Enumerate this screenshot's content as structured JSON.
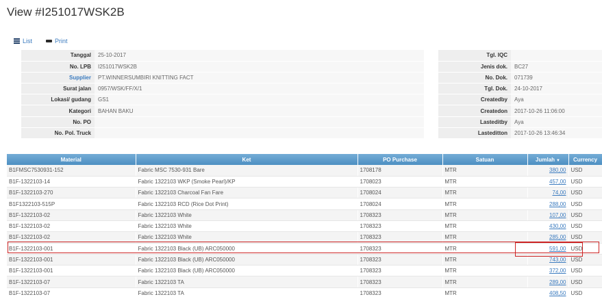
{
  "page": {
    "title": "View #I251017WSK2B"
  },
  "toolbar": {
    "list_label": "List",
    "print_label": "Print"
  },
  "details_left": [
    {
      "label": "Tanggal",
      "value": "25-10-2017"
    },
    {
      "label": "No. LPB",
      "value": "I251017WSK2B"
    },
    {
      "label": "Supplier",
      "value": "PT.WINNERSUMBIRI KNITTING FACT"
    },
    {
      "label": "Surat jalan",
      "value": "0957/WSK/FF/X/1"
    },
    {
      "label": "Lokasi/ gudang",
      "value": "GS1"
    },
    {
      "label": "Kategori",
      "value": "BAHAN BAKU"
    },
    {
      "label": "No. PO",
      "value": ""
    },
    {
      "label": "No. Pol. Truck",
      "value": ""
    }
  ],
  "details_right": [
    {
      "label": "Tgl. IQC",
      "value": ""
    },
    {
      "label": "Jenis dok.",
      "value": "BC27"
    },
    {
      "label": "No. Dok.",
      "value": "071739"
    },
    {
      "label": "Tgl. Dok.",
      "value": "24-10-2017"
    },
    {
      "label": "Createdby",
      "value": "Aya"
    },
    {
      "label": "Createdon",
      "value": "2017-10-26 11:06:00"
    },
    {
      "label": "Lasteditby",
      "value": "Aya"
    },
    {
      "label": "Lasteditton",
      "value": "2017-10-26 13:46:34"
    }
  ],
  "grid": {
    "headers": [
      "Material",
      "Ket",
      "PO Purchase",
      "Satuan",
      "Jumlah",
      "Currency"
    ],
    "sort_indicator": "▼",
    "rows": [
      [
        "B1FMSC7530931-152",
        "Fabric MSC 7530-931 Bare",
        "1708178",
        "MTR",
        "380,00",
        "USD"
      ],
      [
        "B1F-1322103-14",
        "Fabric 1322103 WKP (Smoke Pearl)/KP",
        "1708023",
        "MTR",
        "457,00",
        "USD"
      ],
      [
        "B1F-1322103-270",
        "Fabric 1322103 Charcoal Fan Fare",
        "1708024",
        "MTR",
        "74,00",
        "USD"
      ],
      [
        "B1F1322103-515P",
        "Fabric 1322103 RCD (Rice Dot Print)",
        "1708024",
        "MTR",
        "288,00",
        "USD"
      ],
      [
        "B1F-1322103-02",
        "Fabric 1322103 White",
        "1708323",
        "MTR",
        "107,00",
        "USD"
      ],
      [
        "B1F-1322103-02",
        "Fabric 1322103 White",
        "1708323",
        "MTR",
        "430,00",
        "USD"
      ],
      [
        "B1F-1322103-02",
        "Fabric 1322103 White",
        "1708323",
        "MTR",
        "285,00",
        "USD"
      ],
      [
        "B1F-1322103-001",
        "Fabric 1322103 Black (UB) ARC050000",
        "1708323",
        "MTR",
        "591,00",
        "USD"
      ],
      [
        "B1F-1322103-001",
        "Fabric 1322103 Black (UB) ARC050000",
        "1708323",
        "MTR",
        "743,00",
        "USD"
      ],
      [
        "B1F-1322103-001",
        "Fabric 1322103 Black (UB) ARC050000",
        "1708323",
        "MTR",
        "372,00",
        "USD"
      ],
      [
        "B1F-1322103-07",
        "Fabric 1322103 TA",
        "1708323",
        "MTR",
        "289,00",
        "USD"
      ],
      [
        "B1F-1322103-07",
        "Fabric 1322103 TA",
        "1708323",
        "MTR",
        "408,50",
        "USD"
      ]
    ]
  }
}
